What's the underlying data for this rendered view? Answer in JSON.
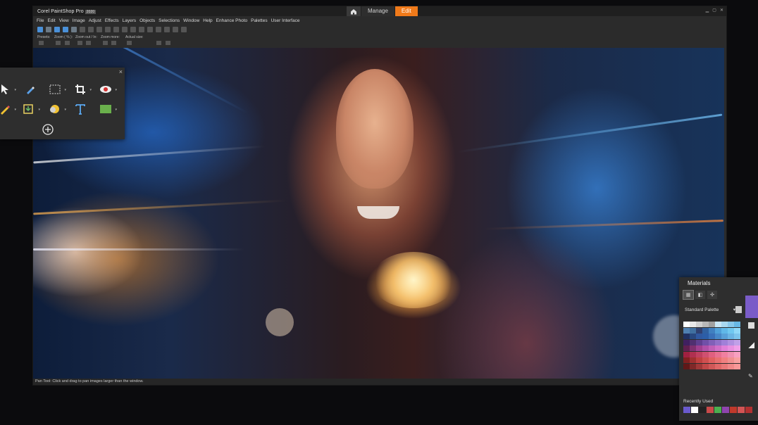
{
  "app": {
    "logo_text": "Corel PaintShop Pro",
    "logo_year": "2020",
    "workspace_tabs": [
      "Manage",
      "Edit"
    ],
    "active_tab": "Edit",
    "menu": [
      "File",
      "Edit",
      "View",
      "Image",
      "Adjust",
      "Effects",
      "Layers",
      "Objects",
      "Selections",
      "Window",
      "Help",
      "Enhance Photo",
      "Palettes",
      "User Interface"
    ],
    "tool_options": {
      "presets_label": "Presets:",
      "zoom_pct_label": "Zoom ( % ):",
      "zoom_in_out_label": "Zoom out / In:",
      "zoom_more_label": "Zoom more:",
      "actual_size_label": "Actual size:"
    },
    "status_text": "Pan Tool: Click and drag to pan images larger than the window."
  },
  "tools_palette": {
    "close_glyph": "×",
    "tools": [
      {
        "name": "pick-tool-icon",
        "glyph": "↖"
      },
      {
        "name": "eyedropper-tool-icon",
        "glyph": "✎"
      },
      {
        "name": "selection-tool-icon",
        "glyph": "⬚"
      },
      {
        "name": "crop-tool-icon",
        "glyph": "⌗"
      },
      {
        "name": "red-eye-tool-icon",
        "glyph": "◉"
      },
      {
        "name": "paint-brush-tool-icon",
        "glyph": "✏"
      },
      {
        "name": "clone-tool-icon",
        "glyph": "⤓"
      },
      {
        "name": "color-replacer-tool-icon",
        "glyph": "◐"
      },
      {
        "name": "text-tool-icon",
        "glyph": "T"
      },
      {
        "name": "rectangle-shape-tool-icon",
        "glyph": "■"
      }
    ],
    "add_glyph": "⊕"
  },
  "materials": {
    "title": "Materials",
    "palette_select": "Standard Palette",
    "recent_label": "Recently Used",
    "accent_color": "#7a5cc8",
    "recent_colors": [
      "#6a5acd",
      "#ffffff",
      "#222222",
      "#c94a4a",
      "#4caf50",
      "#8e44ad",
      "#c0392b",
      "#d35454",
      "#b03030"
    ],
    "swatches": [
      "#ffffff",
      "#e8e8e8",
      "#d0d0d0",
      "#b8b8b8",
      "#a0a0a0",
      "#c8e6f5",
      "#a8d8f0",
      "#88c8ea",
      "#68b8e4",
      "#5080b0",
      "#4070a0",
      "#304070",
      "#3060a0",
      "#4080c0",
      "#50a0d8",
      "#60b8e8",
      "#70c8f0",
      "#90d8f8",
      "#203060",
      "#284880",
      "#3058a0",
      "#2c5ea8",
      "#3a70b8",
      "#4888c8",
      "#58a0d8",
      "#6ab4e4",
      "#7cc4ec",
      "#402060",
      "#503070",
      "#604090",
      "#7050a8",
      "#8060b8",
      "#9070c8",
      "#a080d8",
      "#b090e0",
      "#c0a0e8",
      "#602050",
      "#803070",
      "#a04090",
      "#b050a8",
      "#c060b8",
      "#d070c8",
      "#e080d8",
      "#e890e0",
      "#f0a0e8",
      "#a02040",
      "#b03050",
      "#c04060",
      "#d05070",
      "#e06080",
      "#e87090",
      "#f080a0",
      "#f090b0",
      "#f8a0c0",
      "#802020",
      "#a03030",
      "#c04040",
      "#d05050",
      "#e06060",
      "#e87070",
      "#f08080",
      "#f09090",
      "#f8a0a0",
      "#601818",
      "#802828",
      "#a03838",
      "#c04848",
      "#d05858",
      "#e06868",
      "#e87878",
      "#f08888",
      "#f89898"
    ]
  }
}
